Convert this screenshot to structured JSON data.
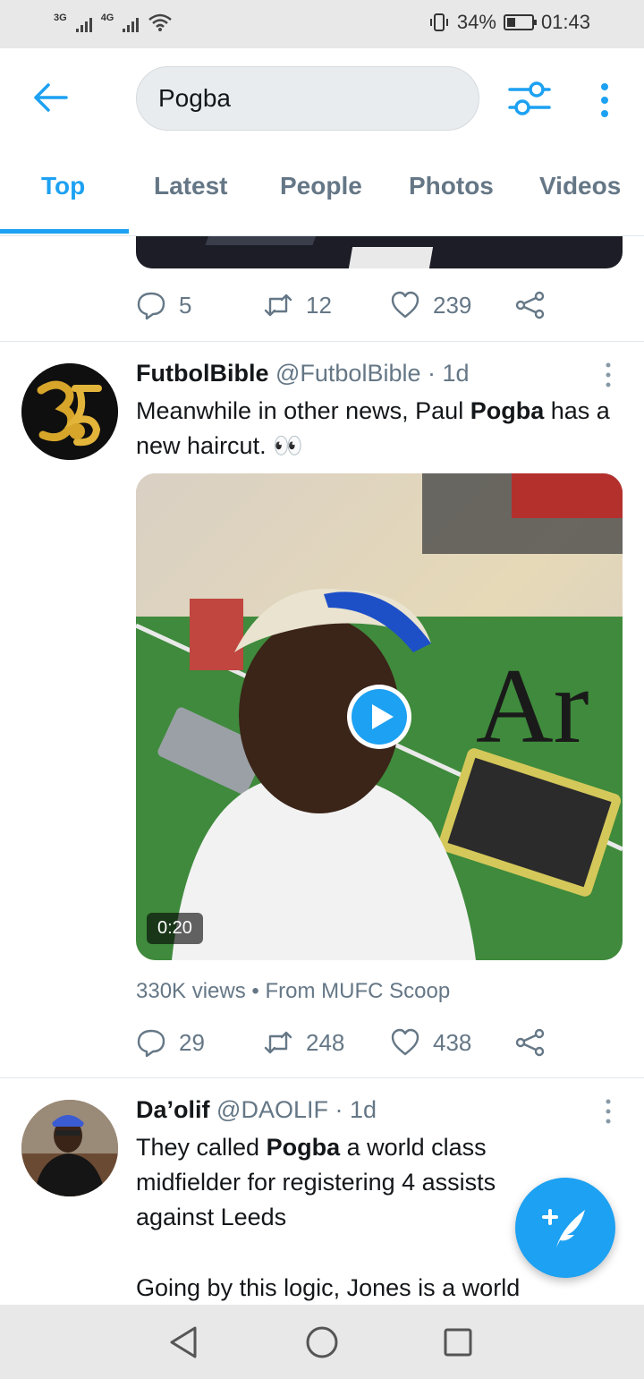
{
  "status_bar": {
    "network_1": "3G",
    "network_2": "4G",
    "battery": "34%",
    "time": "01:43",
    "battery_level": 0.34
  },
  "search": {
    "query": "Pogba",
    "back_icon": "arrow-left-icon",
    "filter_icon": "sliders-icon",
    "more_icon": "more-vertical-icon"
  },
  "tabs": [
    {
      "label": "Top",
      "active": true
    },
    {
      "label": "Latest",
      "active": false
    },
    {
      "label": "People",
      "active": false
    },
    {
      "label": "Photos",
      "active": false
    },
    {
      "label": "Videos",
      "active": false
    }
  ],
  "previous_tweet": {
    "replies": "5",
    "retweets": "12",
    "likes": "239"
  },
  "tweets": [
    {
      "name": "FutbolBible",
      "handle": "@FutbolBible",
      "time": "· 1d",
      "text_before": "Meanwhile in other news, Paul ",
      "text_bold": "Pogba",
      "text_after": " has a new haircut. 👀",
      "video_duration": "0:20",
      "views": "330K views",
      "source": "From MUFC Scoop",
      "separator": "•",
      "replies": "29",
      "retweets": "248",
      "likes": "438"
    },
    {
      "name": "Da’olif",
      "handle": "@DAOLIF",
      "time": "· 1d",
      "text_before": "They called ",
      "text_bold": "Pogba",
      "text_after": " a world class midfielder for registering 4 assists against Leeds",
      "text_para2": "Going by this logic, Jones is a world"
    }
  ],
  "colors": {
    "accent": "#1da1f2",
    "secondary_text": "#657786",
    "primary_text": "#14171a"
  }
}
